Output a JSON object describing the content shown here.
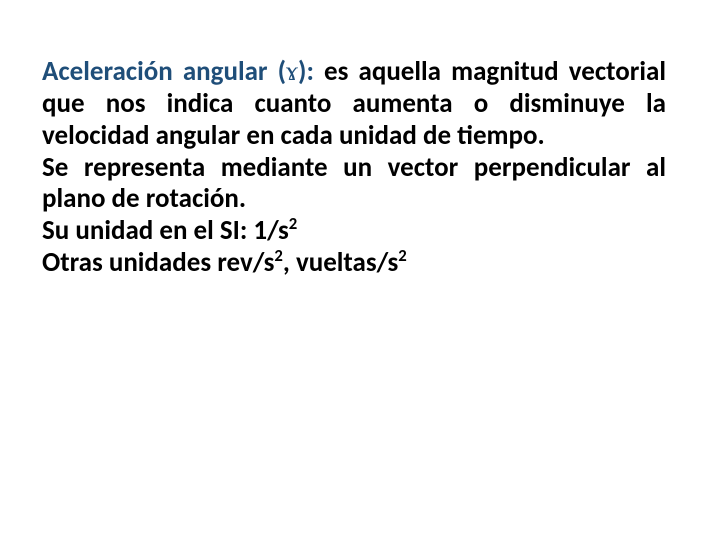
{
  "term_prefix": "Aceleración angular (",
  "term_symbol": "ɤ",
  "term_suffix": "):",
  "def_rest": " es aquella magnitud vectorial que nos indica cuanto aumenta o disminuye la velocidad angular en cada unidad de tiempo.",
  "rep": "Se representa mediante un vector perpendicular al plano de rotación.",
  "si_pre": "Su unidad en el SI: 1/s",
  "si_exp": "2",
  "other_pre": "Otras unidades rev/s",
  "other_mid": ", vueltas/s",
  "exp2": "2"
}
